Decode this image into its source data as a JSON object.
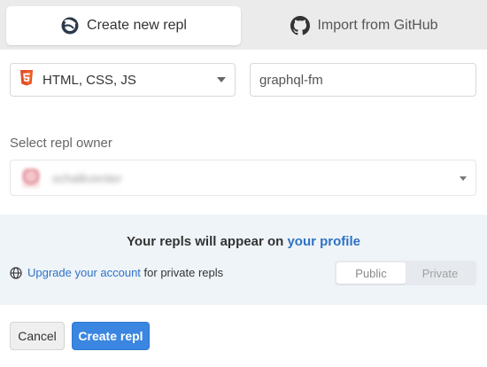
{
  "tabs": [
    {
      "label": "Create new repl",
      "icon": "replit-logo-icon",
      "active": true
    },
    {
      "label": "Import from GitHub",
      "icon": "github-icon",
      "active": false
    }
  ],
  "language": {
    "selected": "HTML, CSS, JS",
    "icon": "html5-icon",
    "icon_color": "#e44d26"
  },
  "repl_name": {
    "value": "graphql-fm",
    "placeholder": "graphql-fm"
  },
  "owner": {
    "label": "Select repl owner",
    "selected": "schalkventer"
  },
  "info": {
    "heading_prefix": "Your repls will appear on",
    "heading_link": "your profile",
    "upgrade_link": "Upgrade your account",
    "upgrade_suffix": "for private repls",
    "visibility_options": [
      "Public",
      "Private"
    ],
    "visibility_selected": "Public"
  },
  "buttons": {
    "cancel": "Cancel",
    "create": "Create repl"
  },
  "colors": {
    "accent": "#3a86e0",
    "link": "#2f72c4",
    "panel_bg": "#eff4f8"
  }
}
